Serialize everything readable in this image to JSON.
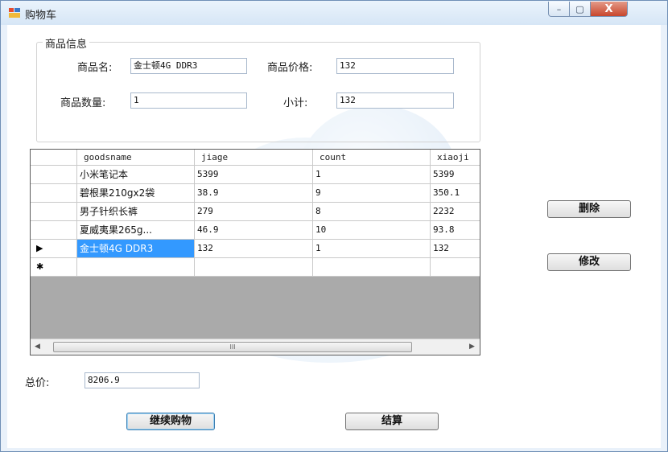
{
  "window": {
    "title": "购物车",
    "icon": "app-window-icon",
    "controls": {
      "minimize": "–",
      "maximize": "▢",
      "close": "X"
    }
  },
  "product_info": {
    "group_title": "商品信息",
    "name_label": "商品名:",
    "name_value": "金士顿4G DDR3",
    "price_label": "商品价格:",
    "price_value": "132",
    "quantity_label": "商品数量:",
    "quantity_value": "1",
    "subtotal_label": "小计:",
    "subtotal_value": "132"
  },
  "grid": {
    "columns": [
      "goodsname",
      "jiage",
      "count",
      "xiaoji"
    ],
    "rows": [
      [
        "小米笔记本",
        "5399",
        "1",
        "5399"
      ],
      [
        "碧根果210gx2袋",
        "38.9",
        "9",
        "350.1"
      ],
      [
        "男子针织长裤",
        "279",
        "8",
        "2232"
      ],
      [
        "夏威夷果265g...",
        "46.9",
        "10",
        "93.8"
      ],
      [
        "金士顿4G DDR3",
        "132",
        "1",
        "132"
      ]
    ],
    "current_row_marker": "▶",
    "new_row_marker": "✱",
    "scroll_left": "◀",
    "scroll_right": "▶",
    "scroll_grip": "III"
  },
  "actions": {
    "delete_label": "删除",
    "modify_label": "修改",
    "continue_label": "继续购物",
    "checkout_label": "结算"
  },
  "total": {
    "label": "总价:",
    "value": "8206.9"
  }
}
